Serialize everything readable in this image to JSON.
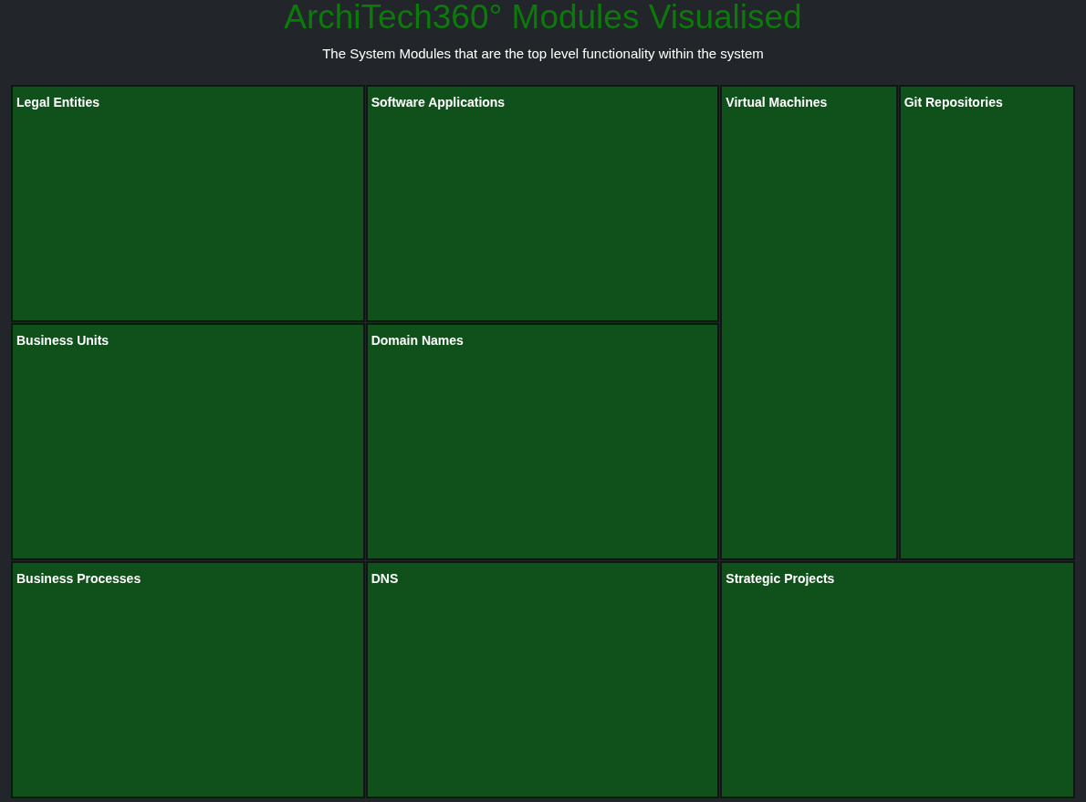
{
  "title": "ArchiTech360° Modules Visualised",
  "subtitle": "The System Modules that are the top level functionality within the system",
  "modules": [
    {
      "label": "Legal Entities"
    },
    {
      "label": "Software Applications"
    },
    {
      "label": "Virtual Machines"
    },
    {
      "label": "Git Repositories"
    },
    {
      "label": "Business Units"
    },
    {
      "label": "Domain Names"
    },
    {
      "label": "Business Processes"
    },
    {
      "label": "DNS"
    },
    {
      "label": "Strategic Projects"
    }
  ]
}
